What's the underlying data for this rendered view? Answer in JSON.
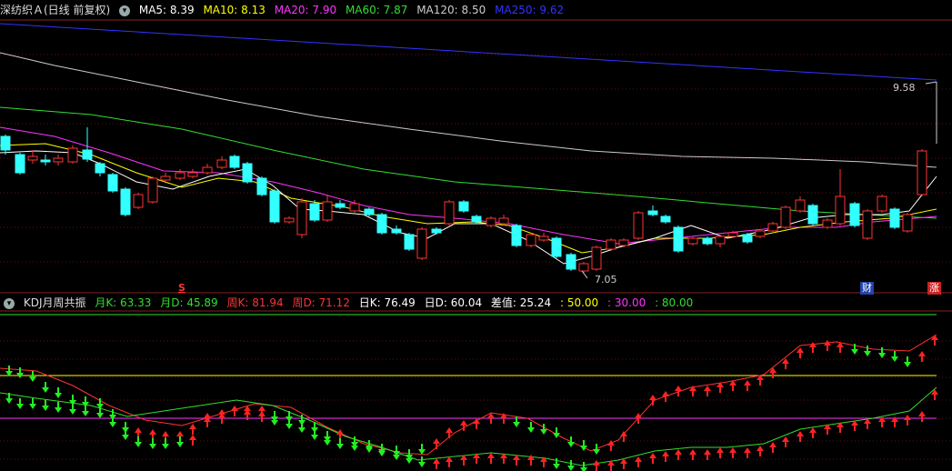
{
  "title": "深纺织Ａ(日线 前复权)",
  "ma_legend": [
    {
      "label": "MA5: 8.39",
      "color": "#ffffff"
    },
    {
      "label": "MA10: 8.13",
      "color": "#ffff00"
    },
    {
      "label": "MA20: 7.90",
      "color": "#ff33ff"
    },
    {
      "label": "MA60: 7.87",
      "color": "#33dd33"
    },
    {
      "label": "MA120: 8.50",
      "color": "#cccccc"
    },
    {
      "label": "MA250: 9.62",
      "color": "#3333ff"
    }
  ],
  "price_high_label": "9.58",
  "price_low_label": "7.05",
  "marker_s": "S",
  "marker_cai": "财",
  "marker_zhang": "涨",
  "kdj_title": "KDJ月周共振",
  "kdj_legend": [
    {
      "label": "月K: 63.33",
      "color": "#33dd33"
    },
    {
      "label": "月D: 45.89",
      "color": "#33dd33"
    },
    {
      "label": "周K: 81.94",
      "color": "#ff3333"
    },
    {
      "label": "周D: 71.12",
      "color": "#ff3333"
    },
    {
      "label": "日K: 76.49",
      "color": "#ffffff"
    },
    {
      "label": "日D: 60.04",
      "color": "#ffffff"
    },
    {
      "label": "差值: 25.24",
      "color": "#ffffff"
    },
    {
      "label": ": 50.00",
      "color": "#ffff00"
    },
    {
      "label": ": 30.00",
      "color": "#ff33ff"
    },
    {
      "label": ": 80.00",
      "color": "#33dd33"
    }
  ],
  "colors": {
    "up": "#ff3333",
    "down": "#33ffff",
    "ma5": "#ffffff",
    "ma10": "#ffff00",
    "ma20": "#ff33ff",
    "ma60": "#33dd33",
    "ma120": "#cccccc",
    "ma250": "#3333ff"
  }
}
